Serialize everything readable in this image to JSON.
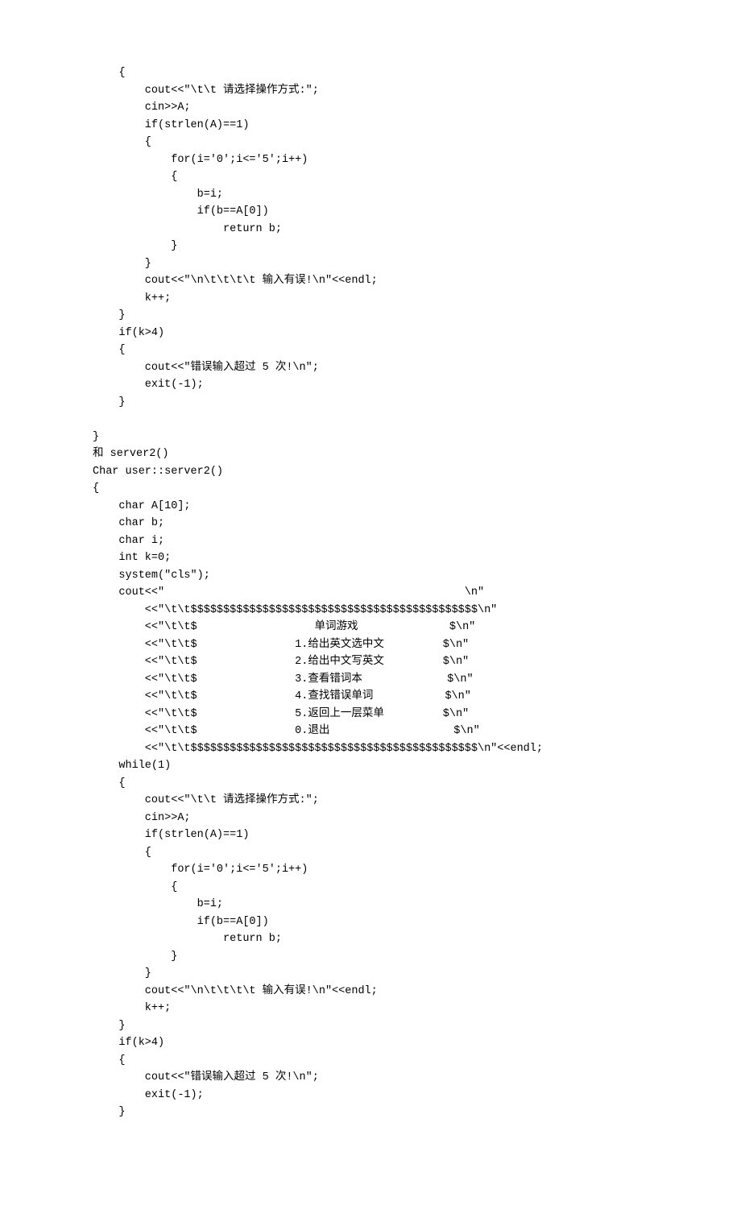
{
  "code": {
    "lines": [
      "    {",
      "        cout<<\"\\t\\t 请选择操作方式:\";",
      "        cin>>A;",
      "        if(strlen(A)==1)",
      "        {",
      "            for(i='0';i<='5';i++)",
      "            {",
      "                b=i;",
      "                if(b==A[0])",
      "                    return b;",
      "            }",
      "        }",
      "        cout<<\"\\n\\t\\t\\t\\t 输入有误!\\n\"<<endl;",
      "        k++;",
      "    }",
      "    if(k>4)",
      "    {",
      "        cout<<\"错误输入超过 5 次!\\n\";",
      "        exit(-1);",
      "    }",
      "",
      "}",
      "和 server2()",
      "Char user::server2()",
      "{",
      "    char A[10];",
      "    char b;",
      "    char i;",
      "    int k=0;",
      "    system(\"cls\");",
      "    cout<<\"                                              \\n\"",
      "        <<\"\\t\\t$$$$$$$$$$$$$$$$$$$$$$$$$$$$$$$$$$$$$$$$$$$$\\n\"",
      "        <<\"\\t\\t$                  单词游戏              $\\n\"",
      "        <<\"\\t\\t$               1.给出英文选中文         $\\n\"",
      "        <<\"\\t\\t$               2.给出中文写英文         $\\n\"",
      "        <<\"\\t\\t$               3.查看错词本             $\\n\"",
      "        <<\"\\t\\t$               4.查找错误单词           $\\n\"",
      "        <<\"\\t\\t$               5.返回上一层菜单         $\\n\"",
      "        <<\"\\t\\t$               0.退出                   $\\n\"",
      "        <<\"\\t\\t$$$$$$$$$$$$$$$$$$$$$$$$$$$$$$$$$$$$$$$$$$$$\\n\"<<endl;",
      "    while(1)",
      "    {",
      "        cout<<\"\\t\\t 请选择操作方式:\";",
      "        cin>>A;",
      "        if(strlen(A)==1)",
      "        {",
      "            for(i='0';i<='5';i++)",
      "            {",
      "                b=i;",
      "                if(b==A[0])",
      "                    return b;",
      "            }",
      "        }",
      "        cout<<\"\\n\\t\\t\\t\\t 输入有误!\\n\"<<endl;",
      "        k++;",
      "    }",
      "    if(k>4)",
      "    {",
      "        cout<<\"错误输入超过 5 次!\\n\";",
      "        exit(-1);",
      "    }"
    ]
  }
}
